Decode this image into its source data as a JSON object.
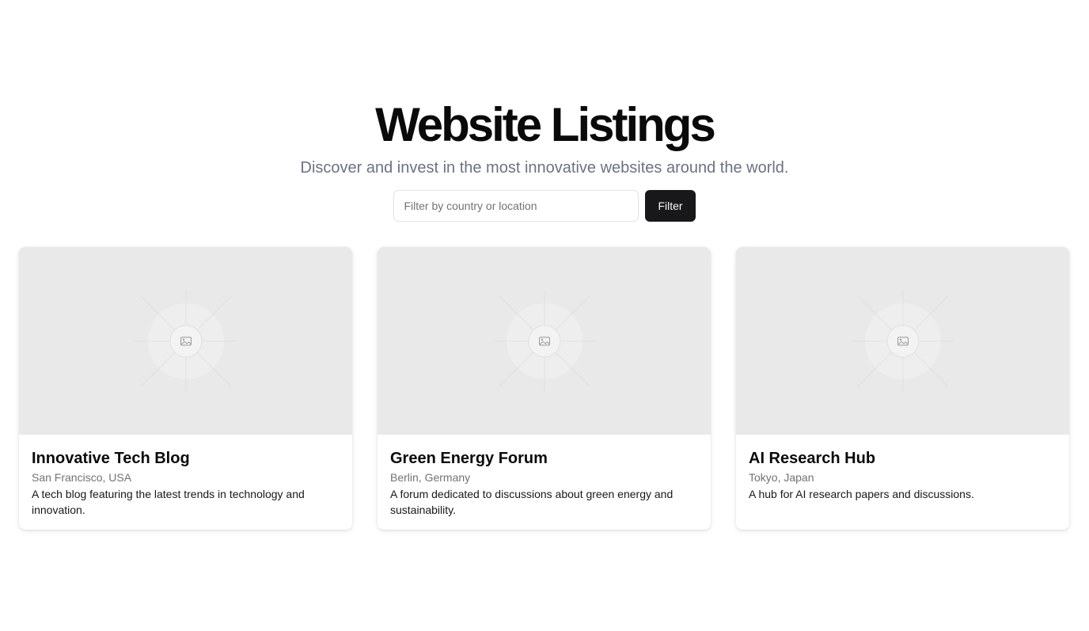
{
  "header": {
    "title": "Website Listings",
    "subtitle": "Discover and invest in the most innovative websites around the world."
  },
  "filter": {
    "placeholder": "Filter by country or location",
    "value": "",
    "button_label": "Filter"
  },
  "listings": [
    {
      "title": "Innovative Tech Blog",
      "location": "San Francisco, USA",
      "description": "A tech blog featuring the latest trends in technology and innovation.",
      "image_icon": "image-placeholder-icon"
    },
    {
      "title": "Green Energy Forum",
      "location": "Berlin, Germany",
      "description": "A forum dedicated to discussions about green energy and sustainability.",
      "image_icon": "image-placeholder-icon"
    },
    {
      "title": "AI Research Hub",
      "location": "Tokyo, Japan",
      "description": "A hub for AI research papers and discussions.",
      "image_icon": "image-placeholder-icon"
    }
  ],
  "colors": {
    "button_bg": "#18181b",
    "placeholder_bg": "#e9e9e9",
    "muted_text": "#6b7280"
  }
}
